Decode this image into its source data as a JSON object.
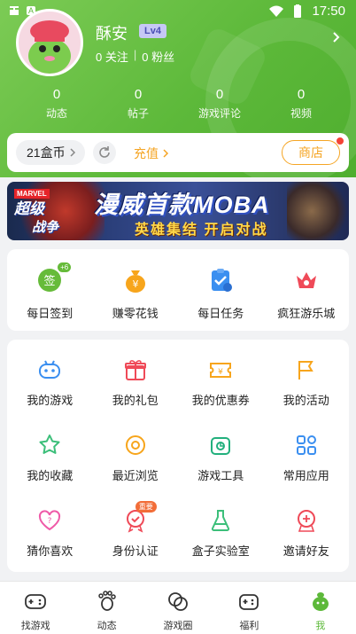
{
  "statusbar": {
    "time": "17:50",
    "badge": "A"
  },
  "profile": {
    "username": "酥安",
    "level": "Lv4",
    "follow_label": "0 关注",
    "fans_label": "0 粉丝"
  },
  "stats": [
    {
      "num": "0",
      "label": "动态"
    },
    {
      "num": "0",
      "label": "帖子"
    },
    {
      "num": "0",
      "label": "游戏评论"
    },
    {
      "num": "0",
      "label": "视频"
    }
  ],
  "coins": {
    "label": "21盒币",
    "recharge": "充值",
    "shop": "商店"
  },
  "banner": {
    "brand": "MARVEL",
    "logo_line1": "超级",
    "logo_line2": "战争",
    "title": "漫威首款MOBA",
    "subtitle": "英雄集结 开启对战"
  },
  "quick": [
    {
      "label": "每日签到",
      "icon": "sign-in-icon",
      "badge": "+6"
    },
    {
      "label": "赚零花钱",
      "icon": "money-bag-icon"
    },
    {
      "label": "每日任务",
      "icon": "task-icon"
    },
    {
      "label": "疯狂游乐城",
      "icon": "crown-icon"
    }
  ],
  "grid": [
    {
      "label": "我的游戏",
      "icon": "gamepad-icon"
    },
    {
      "label": "我的礼包",
      "icon": "gift-icon"
    },
    {
      "label": "我的优惠券",
      "icon": "coupon-icon"
    },
    {
      "label": "我的活动",
      "icon": "flag-icon"
    },
    {
      "label": "我的收藏",
      "icon": "star-icon"
    },
    {
      "label": "最近浏览",
      "icon": "eye-icon"
    },
    {
      "label": "游戏工具",
      "icon": "toolbox-icon"
    },
    {
      "label": "常用应用",
      "icon": "apps-icon"
    },
    {
      "label": "猜你喜欢",
      "icon": "heart-question-icon"
    },
    {
      "label": "身份认证",
      "icon": "verify-icon",
      "badge": "重要"
    },
    {
      "label": "盒子实验室",
      "icon": "flask-icon"
    },
    {
      "label": "邀请好友",
      "icon": "invite-icon"
    }
  ],
  "nav": [
    {
      "label": "找游戏",
      "icon": "game-controller-icon"
    },
    {
      "label": "动态",
      "icon": "footprint-icon"
    },
    {
      "label": "游戏圈",
      "icon": "circle-icon"
    },
    {
      "label": "福利",
      "icon": "gift-box-icon"
    },
    {
      "label": "我",
      "icon": "me-icon",
      "active": true
    }
  ],
  "colors": {
    "brand_green": "#5db93a",
    "accent_orange": "#f5a524",
    "level_bg": "#c6c8f5"
  }
}
